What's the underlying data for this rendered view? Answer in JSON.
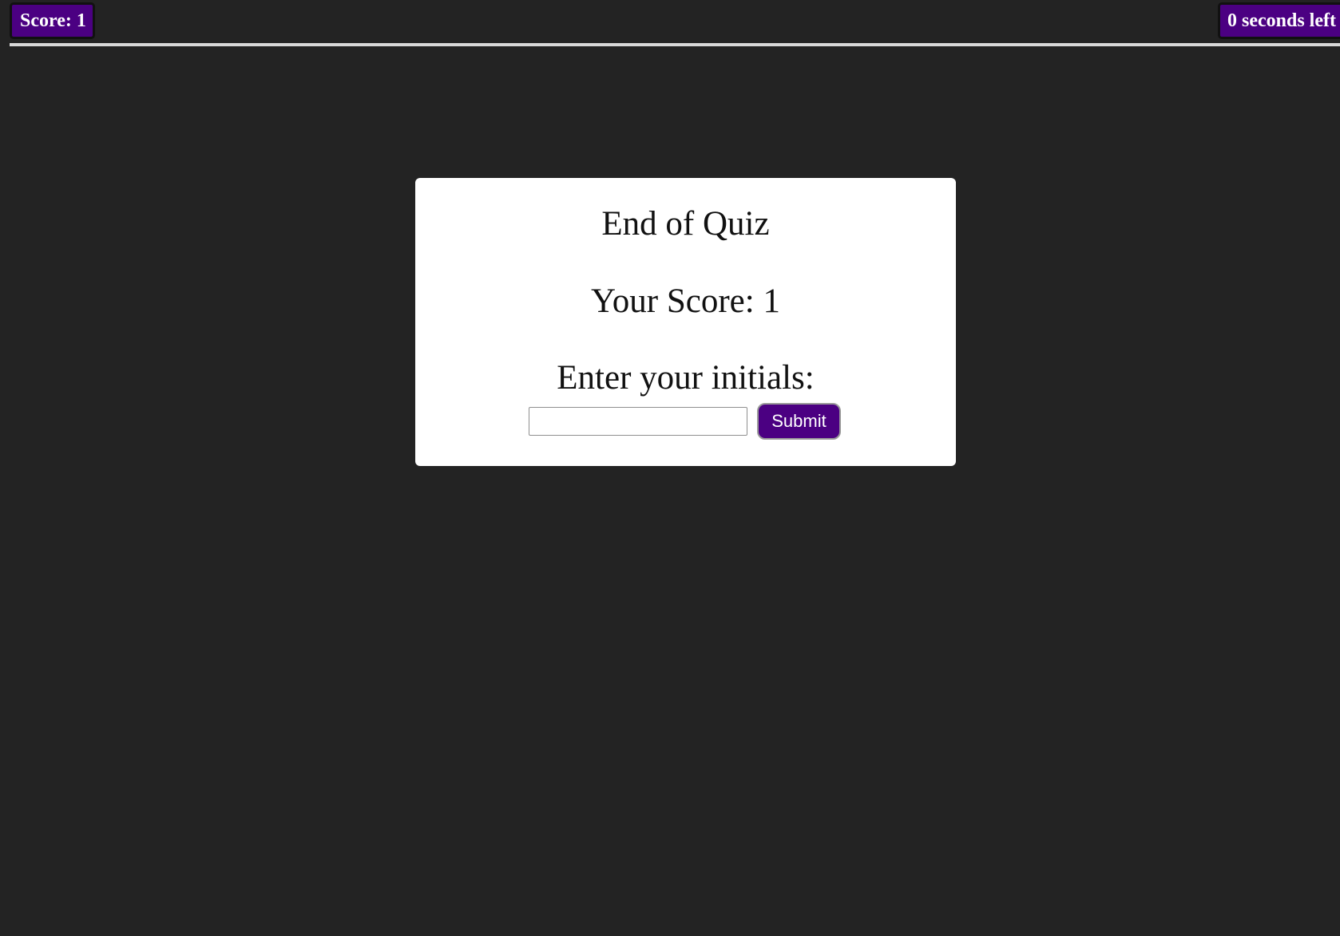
{
  "header": {
    "score_label": "Score: 1",
    "timer_label": "0 seconds left"
  },
  "end_card": {
    "title": "End of Quiz",
    "score_text": "Your Score: 1",
    "prompt": "Enter your initials:",
    "initials_value": "",
    "submit_label": "Submit"
  },
  "colors": {
    "background": "#232323",
    "accent": "#4b0082",
    "card": "#ffffff"
  }
}
